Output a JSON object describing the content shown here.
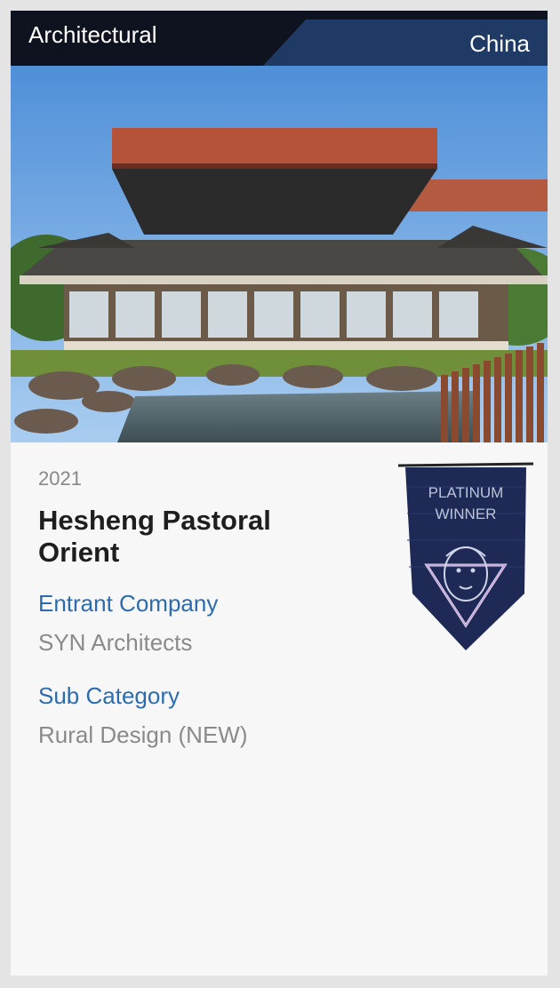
{
  "header": {
    "category": "Architectural",
    "country": "China",
    "colors": {
      "dark": "#0f1320",
      "accent_band": "#1f3a64"
    }
  },
  "entry": {
    "year": "2021",
    "title": "Hesheng Pastoral Orient",
    "entrant_label": "Entrant Company",
    "entrant_value": "SYN Architects",
    "subcat_label": "Sub Category",
    "subcat_value": "Rural Design (NEW)"
  },
  "badge": {
    "line1": "PLATINUM",
    "line2": "WINNER",
    "icon": "platinum-winner-badge-icon"
  },
  "colors": {
    "label_blue": "#2b6cb0",
    "value_gray": "#8a8a8a",
    "title_dark": "#1e1e1e"
  }
}
